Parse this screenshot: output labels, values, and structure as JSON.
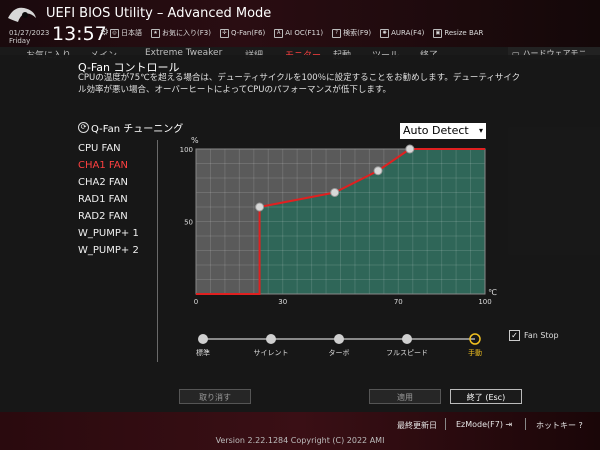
{
  "header": {
    "title": "UEFI BIOS Utility – Advanced Mode",
    "date": "01/27/2023",
    "day": "Friday",
    "time": "13:57",
    "toolbar": [
      {
        "label": "日本語",
        "icon": "globe-icon"
      },
      {
        "label": "お気に入り(F3)",
        "icon": "star-icon"
      },
      {
        "label": "Q-Fan(F6)",
        "icon": "fan-icon"
      },
      {
        "label": "AI OC(F11)",
        "icon": "ai-icon"
      },
      {
        "label": "検索(F9)",
        "icon": "help-icon"
      },
      {
        "label": "AURA(F4)",
        "icon": "aura-icon"
      },
      {
        "label": "Resize BAR",
        "icon": "resize-icon"
      }
    ]
  },
  "tabs": [
    {
      "label": "お気に入り"
    },
    {
      "label": "メイン"
    },
    {
      "label": "Extreme Tweaker"
    },
    {
      "label": "詳細"
    },
    {
      "label": "モニター",
      "active": true
    },
    {
      "label": "起動"
    },
    {
      "label": "ツール"
    },
    {
      "label": "終了"
    }
  ],
  "hardware_monitor_label": "ハードウェアモニ",
  "qfan": {
    "title": "Q-Fan コントロール",
    "description": "CPUの温度が75℃を超える場合は、デューティサイクルを100％に設定することをお勧めします。デューティサイクル効率が悪い場合、オーバーヒートによってCPUのパフォーマンスが低下します。",
    "tuning_title": "Q-Fan チューニング",
    "fans": [
      "CPU FAN",
      "CHA1 FAN",
      "CHA2 FAN",
      "RAD1 FAN",
      "RAD2 FAN",
      "W_PUMP+ 1",
      "W_PUMP+ 2"
    ],
    "selected_fan": "CHA1 FAN",
    "mode_select": "Auto Detect",
    "presets": [
      {
        "label": "標準"
      },
      {
        "label": "サイレント"
      },
      {
        "label": "ターボ"
      },
      {
        "label": "フルスピード"
      },
      {
        "label": "手動",
        "active": true
      }
    ],
    "fan_stop_label": "Fan Stop",
    "fan_stop_checked": true
  },
  "chart_data": {
    "type": "line",
    "ylabel": "%",
    "xlabel": "℃",
    "xlim": [
      0,
      100
    ],
    "ylim": [
      0,
      100
    ],
    "xticks": [
      "0",
      "30",
      "70",
      "100"
    ],
    "yticks": [
      "50",
      "100"
    ],
    "grid": true,
    "series": [
      {
        "x": [
          0,
          22,
          22,
          48,
          63,
          74,
          100
        ],
        "y": [
          0,
          0,
          60,
          70,
          85,
          100,
          100
        ],
        "color": "#e02020"
      }
    ],
    "control_points": [
      {
        "x": 22,
        "y": 60
      },
      {
        "x": 48,
        "y": 70
      },
      {
        "x": 63,
        "y": 85
      },
      {
        "x": 74,
        "y": 100
      }
    ]
  },
  "buttons": {
    "undo": "取り消す",
    "apply": "適用",
    "exit": "終了 (Esc)"
  },
  "footer": {
    "last_modified": "最終更新日",
    "ezmode": "EzMode(F7)",
    "hotkeys": "ホットキー",
    "copyright": "Version 2.22.1284 Copyright (C) 2022 AMI"
  },
  "colors": {
    "accent": "#e02020",
    "chart_bg": "#2f6658",
    "chart_line": "#e02020"
  }
}
